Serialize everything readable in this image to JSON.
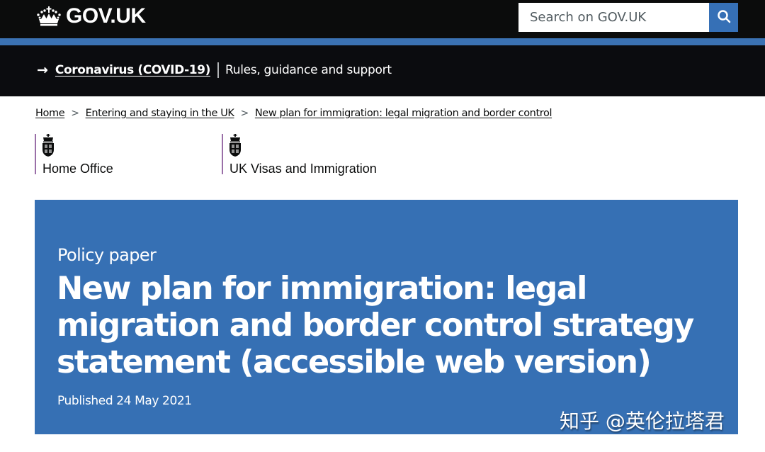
{
  "header": {
    "logo_text": "GOV.UK",
    "logo_icon": "crown-icon",
    "search": {
      "placeholder": "Search on GOV.UK",
      "value": "",
      "button_icon": "search-icon",
      "button_label": "Search"
    }
  },
  "colors": {
    "header_bg": "#0b0c0c",
    "accent_bar": "#3b72b3",
    "search_button": "#3670b6",
    "hero_bg": "#3670b4",
    "org_border": "#9a6fa8"
  },
  "covid_banner": {
    "arrow_icon": "arrow-right-icon",
    "link_text": "Coronavirus (COVID-19)",
    "description": "Rules, guidance and support"
  },
  "breadcrumb": {
    "items": [
      {
        "label": "Home"
      },
      {
        "label": "Entering and staying in the UK"
      },
      {
        "label": "New plan for immigration: legal migration and border control"
      }
    ],
    "separator_icon": "chevron-right-icon"
  },
  "organisations": [
    {
      "name": "Home Office",
      "icon": "royal-crest-icon"
    },
    {
      "name": "UK Visas and Immigration",
      "icon": "royal-crest-icon"
    }
  ],
  "hero": {
    "context": "Policy paper",
    "title": "New plan for immigration: legal migration and border control strategy statement (accessible web version)",
    "published": "Published 24 May 2021"
  },
  "watermark": {
    "text": "知乎 @英伦拉塔君"
  }
}
